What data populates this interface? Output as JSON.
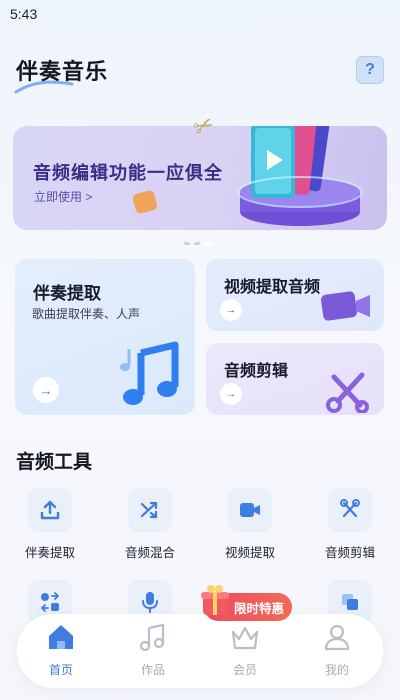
{
  "status": {
    "time": "5:43"
  },
  "header": {
    "title": "伴奏音乐",
    "help_label": "?"
  },
  "banner": {
    "title": "音频编辑功能一应俱全",
    "link": "立即使用 >"
  },
  "cards": {
    "accompaniment": {
      "title": "伴奏提取",
      "subtitle": "歌曲提取伴奏、人声",
      "arrow": "→"
    },
    "video_audio": {
      "title": "视频提取音频",
      "arrow": "→"
    },
    "audio_cut": {
      "title": "音频剪辑",
      "arrow": "→"
    }
  },
  "section": {
    "title": "音频工具"
  },
  "tools": [
    {
      "label": "伴奏提取",
      "icon": "upload-icon"
    },
    {
      "label": "音频混合",
      "icon": "shuffle-icon"
    },
    {
      "label": "视频提取",
      "icon": "video-icon"
    },
    {
      "label": "音频剪辑",
      "icon": "scissors-icon"
    },
    {
      "label": "",
      "icon": "convert-icon"
    },
    {
      "label": "",
      "icon": "microphone-icon"
    },
    {
      "label": "",
      "icon": "unknown-icon"
    },
    {
      "label": "",
      "icon": "layers-icon"
    }
  ],
  "promo": {
    "label": "限时特惠"
  },
  "tabbar": [
    {
      "label": "首页",
      "icon": "home-icon",
      "active": true
    },
    {
      "label": "作品",
      "icon": "music-note-icon",
      "active": false
    },
    {
      "label": "会员",
      "icon": "crown-icon",
      "active": false
    },
    {
      "label": "我的",
      "icon": "user-icon",
      "active": false
    }
  ],
  "colors": {
    "accent": "#3f7de0",
    "banner_text": "#3b2d86",
    "promo": "#ee4a62"
  }
}
